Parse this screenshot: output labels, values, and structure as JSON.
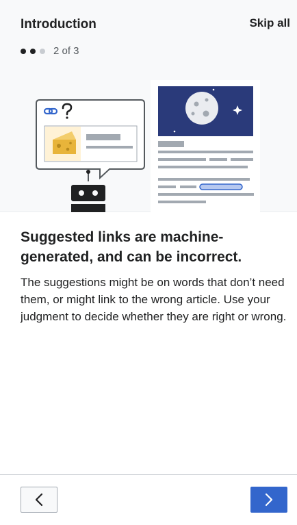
{
  "header": {
    "title": "Introduction",
    "skip_label": "Skip all"
  },
  "progress": {
    "current": 2,
    "total": 3,
    "label": "2 of 3"
  },
  "content": {
    "heading": "Suggested links are machine-generated, and can be incorrect.",
    "description": "The suggestions might be on words that don’t need them, or might link to the wrong article. Use your judgment to decide whether they are right or wrong."
  },
  "footer": {
    "back_icon": "chevron-left-icon",
    "next_icon": "chevron-right-icon"
  },
  "colors": {
    "accent": "#3366cc",
    "text": "#202122",
    "panel_background": "#f8f9fa",
    "illustration_navy": "#2a3a7a",
    "cheese": "#e8b43a"
  }
}
